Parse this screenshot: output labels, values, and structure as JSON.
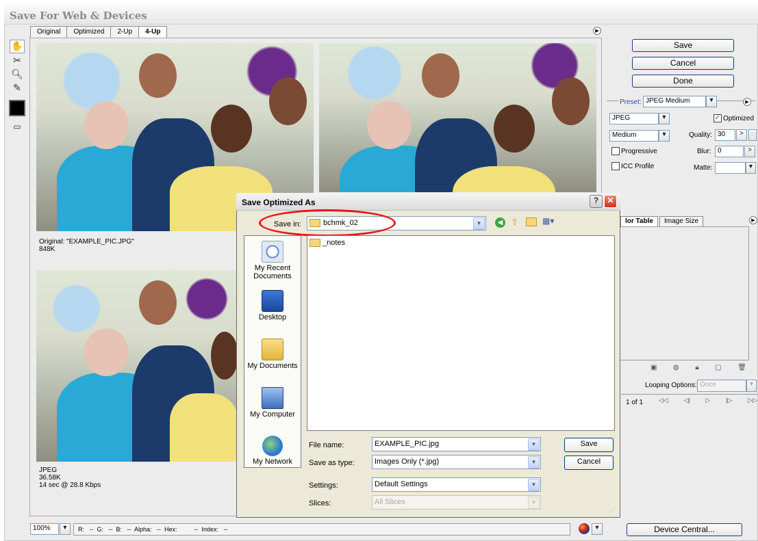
{
  "window": {
    "title": "Save For Web & Devices"
  },
  "view_tabs": [
    {
      "label": "Original"
    },
    {
      "label": "Optimized"
    },
    {
      "label": "2-Up"
    },
    {
      "label": "4-Up"
    }
  ],
  "panes": {
    "original_info": {
      "line1": "Original: \"EXAMPLE_PIC.JPG\"",
      "line2": "848K"
    },
    "optimized_info": {
      "line1": "JPEG",
      "line2": "36.58K",
      "line3": "14 sec @ 28.8 Kbps"
    }
  },
  "right_panel": {
    "save": "Save",
    "cancel": "Cancel",
    "done": "Done",
    "preset_label": "Preset:",
    "preset_value": "JPEG Medium",
    "format": "JPEG",
    "optimized_label": "Optimized",
    "quality_level": "Medium",
    "quality_label": "Quality:",
    "quality_value": "30",
    "progressive_label": "Progressive",
    "blur_label": "Blur:",
    "blur_value": "0",
    "icc_label": "ICC Profile",
    "matte_label": "Matte:",
    "tab_color_table": "lor Table",
    "tab_image_size": "Image Size",
    "looping_label": "Looping Options:",
    "looping_value": "Once",
    "frame_counter": "1 of 1",
    "device_central": "Device Central..."
  },
  "dialog": {
    "title": "Save Optimized As",
    "help_btn": "?",
    "save_in_label": "Save in:",
    "save_in_value": "bchmk_02",
    "places": [
      {
        "label": "My Recent Documents",
        "icon": "recent-documents-icon"
      },
      {
        "label": "Desktop",
        "icon": "desktop-icon"
      },
      {
        "label": "My Documents",
        "icon": "my-documents-icon"
      },
      {
        "label": "My Computer",
        "icon": "my-computer-icon"
      },
      {
        "label": "My Network",
        "icon": "my-network-icon"
      }
    ],
    "files": [
      {
        "name": "_notes"
      }
    ],
    "file_name_label": "File name:",
    "file_name_value": "EXAMPLE_PIC.jpg",
    "save_as_type_label": "Save as type:",
    "save_as_type_value": "Images Only (*.jpg)",
    "settings_label": "Settings:",
    "settings_value": "Default Settings",
    "slices_label": "Slices:",
    "slices_value": "All Slices",
    "save_button": "Save",
    "cancel_button": "Cancel"
  },
  "status_bar": {
    "zoom": "100%",
    "readout": "R:   --  G:   --  B:   --  Alpha:   --  Hex:          --  Index:   --"
  },
  "colors": {
    "annotation_red": "#e8141b",
    "dialog_face": "#ece9d8",
    "xp_close": "#d9452b"
  }
}
